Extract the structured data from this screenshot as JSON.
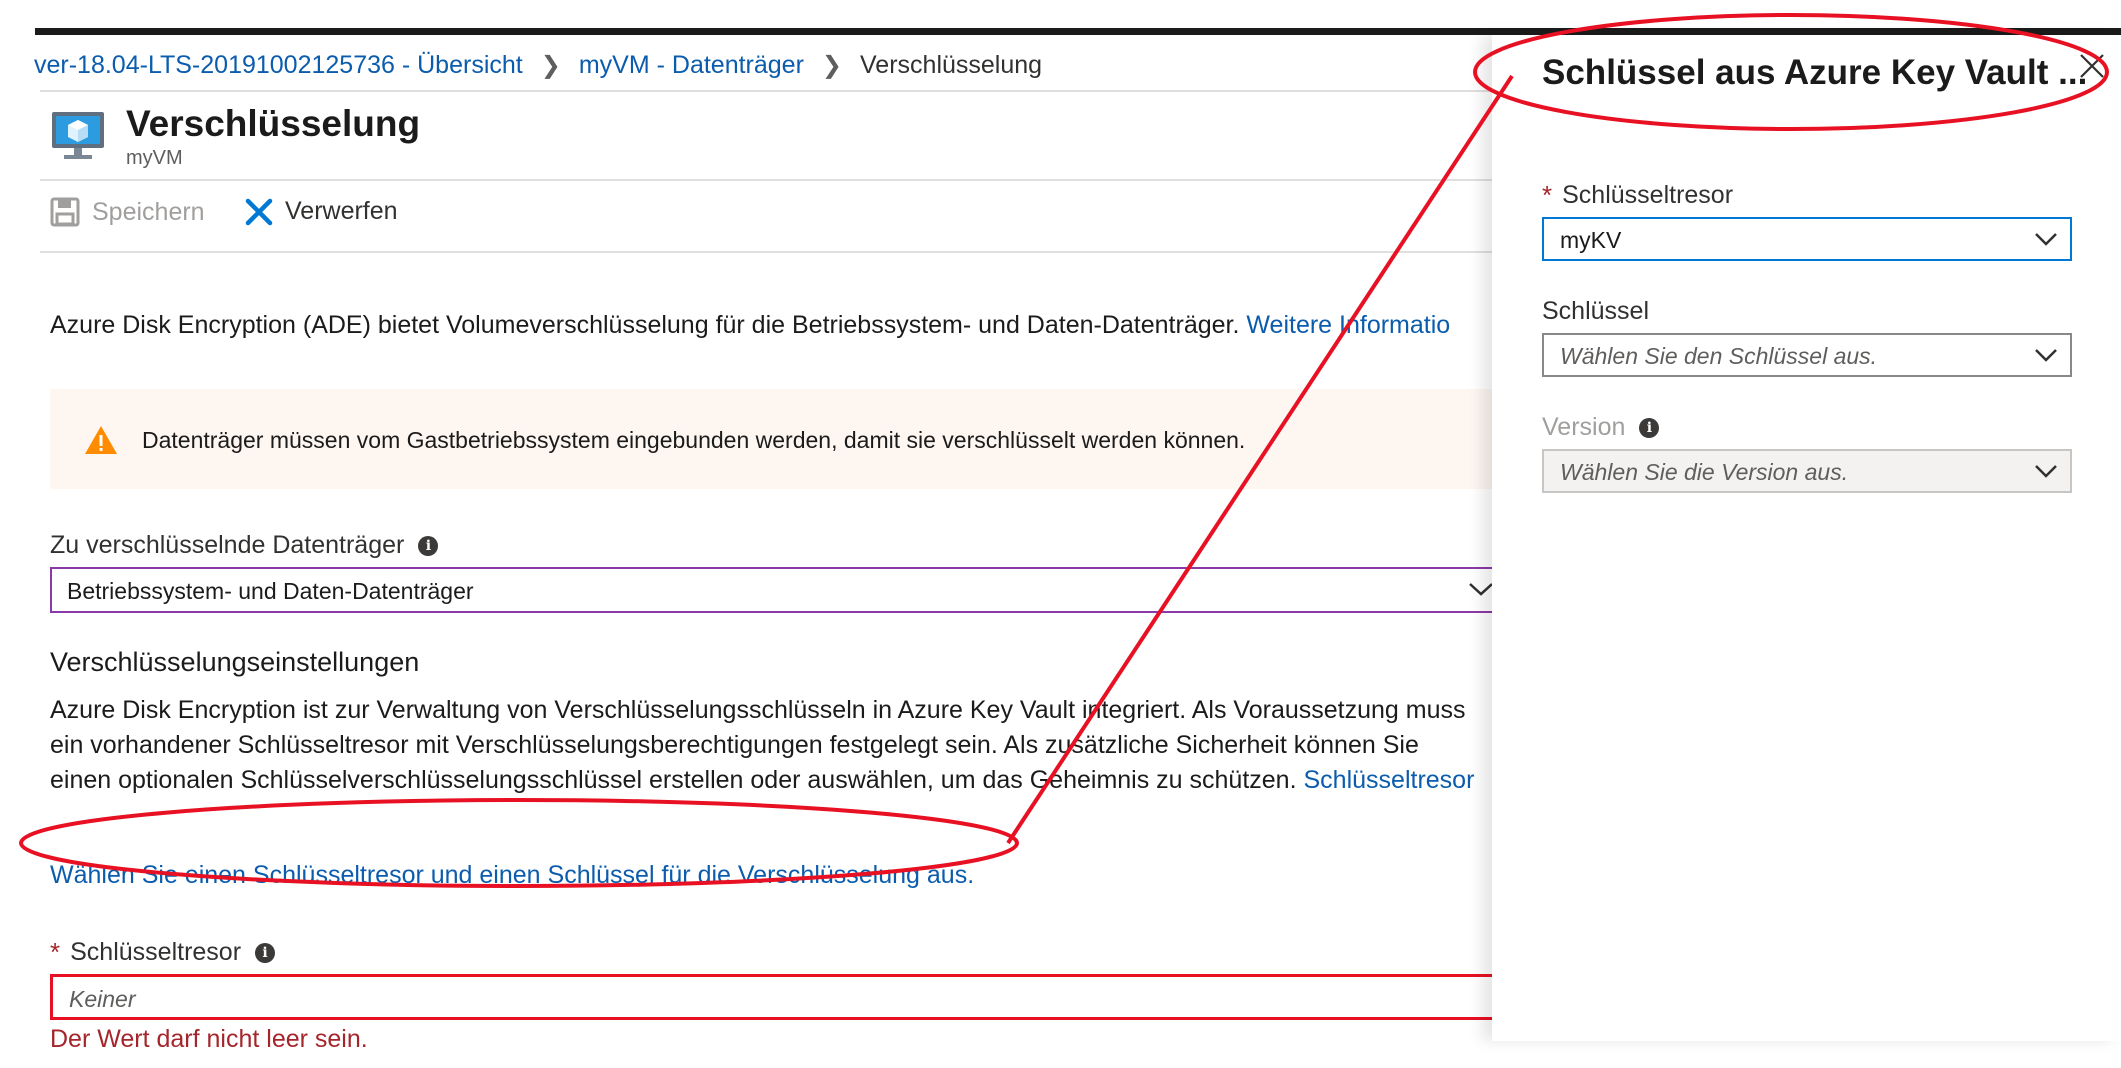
{
  "breadcrumb": {
    "items": [
      "ver-18.04-LTS-20191002125736 - Übersicht",
      "myVM - Datenträger"
    ],
    "current": "Verschlüsselung"
  },
  "header": {
    "title": "Verschlüsselung",
    "subtitle": "myVM",
    "icon": "virtual-machine-icon"
  },
  "toolbar": {
    "save_label": "Speichern",
    "discard_label": "Verwerfen"
  },
  "description": {
    "text": "Azure Disk Encryption (ADE) bietet Volumeverschlüsselung für die Betriebssystem- und Daten-Datenträger.",
    "link": "Weitere Informatio"
  },
  "warning": {
    "text": "Datenträger müssen vom Gastbetriebssystem eingebunden werden, damit sie verschlüsselt werden können.",
    "icon": "warning-icon"
  },
  "disks": {
    "label": "Zu verschlüsselnde Datenträger",
    "value": "Betriebssystem- und Daten-Datenträger"
  },
  "settings": {
    "title": "Verschlüsselungseinstellungen",
    "lines": [
      "Azure Disk Encryption ist zur Verwaltung von Verschlüsselungsschlüsseln in Azure Key Vault integriert. Als Voraussetzung muss",
      "ein vorhandener Schlüsseltresor mit Verschlüsselungsberechtigungen festgelegt sein. Als zusätzliche Sicherheit können Sie",
      "einen optionalen Schlüsselverschlüsselungsschlüssel erstellen oder auswählen, um das Geheimnis zu schützen."
    ],
    "link": "Schlüsseltresor",
    "choose_link": "Wählen Sie einen Schlüsseltresor und einen Schlüssel für die Verschlüsselung aus."
  },
  "keyvault": {
    "required_mark": "*",
    "label": "Schlüsseltresor",
    "placeholder": "Keiner",
    "error": "Der Wert darf nicht leer sein."
  },
  "panel": {
    "title": "Schlüssel aus Azure Key Vault ...",
    "vault_label": "Schlüsseltresor",
    "vault_value": "myKV",
    "key_label": "Schlüssel",
    "key_placeholder": "Wählen Sie den Schlüssel aus.",
    "version_label": "Version",
    "version_placeholder": "Wählen Sie die Version aus."
  },
  "colors": {
    "link": "#0b5cad",
    "annotation": "#e81123",
    "focus": "#0078d4",
    "error": "#a4262c"
  }
}
